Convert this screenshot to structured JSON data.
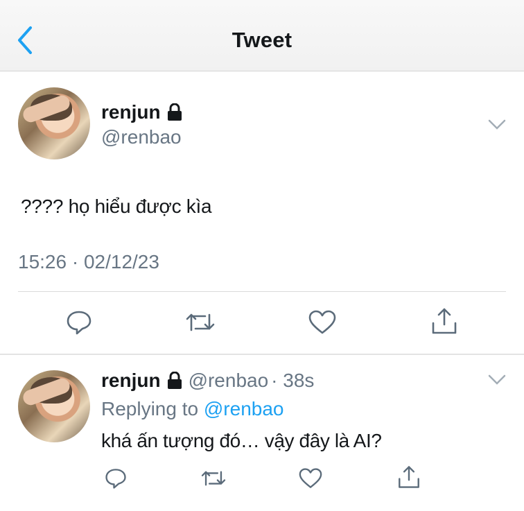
{
  "header": {
    "title": "Tweet"
  },
  "tweet": {
    "author_name": "renjun",
    "author_handle": "@renbao",
    "text": "???? họ hiểu được kìa",
    "timestamp": "15:26 · 02/12/23"
  },
  "reply": {
    "author_name": "renjun",
    "author_handle": "@renbao",
    "age": "· 38s",
    "replying_prefix": "Replying to ",
    "replying_to": "@renbao",
    "text": "khá ấn tượng đó… vậy đây là AI?"
  },
  "icons": {
    "back": "chevron-left-icon",
    "lock": "lock-icon",
    "more": "chevron-down-icon",
    "reply": "speech-bubble-icon",
    "retweet": "retweet-icon",
    "like": "heart-icon",
    "share": "share-icon"
  },
  "colors": {
    "accent": "#1da1f2",
    "secondary_text": "#687684",
    "icon": "#5b6b7a"
  }
}
